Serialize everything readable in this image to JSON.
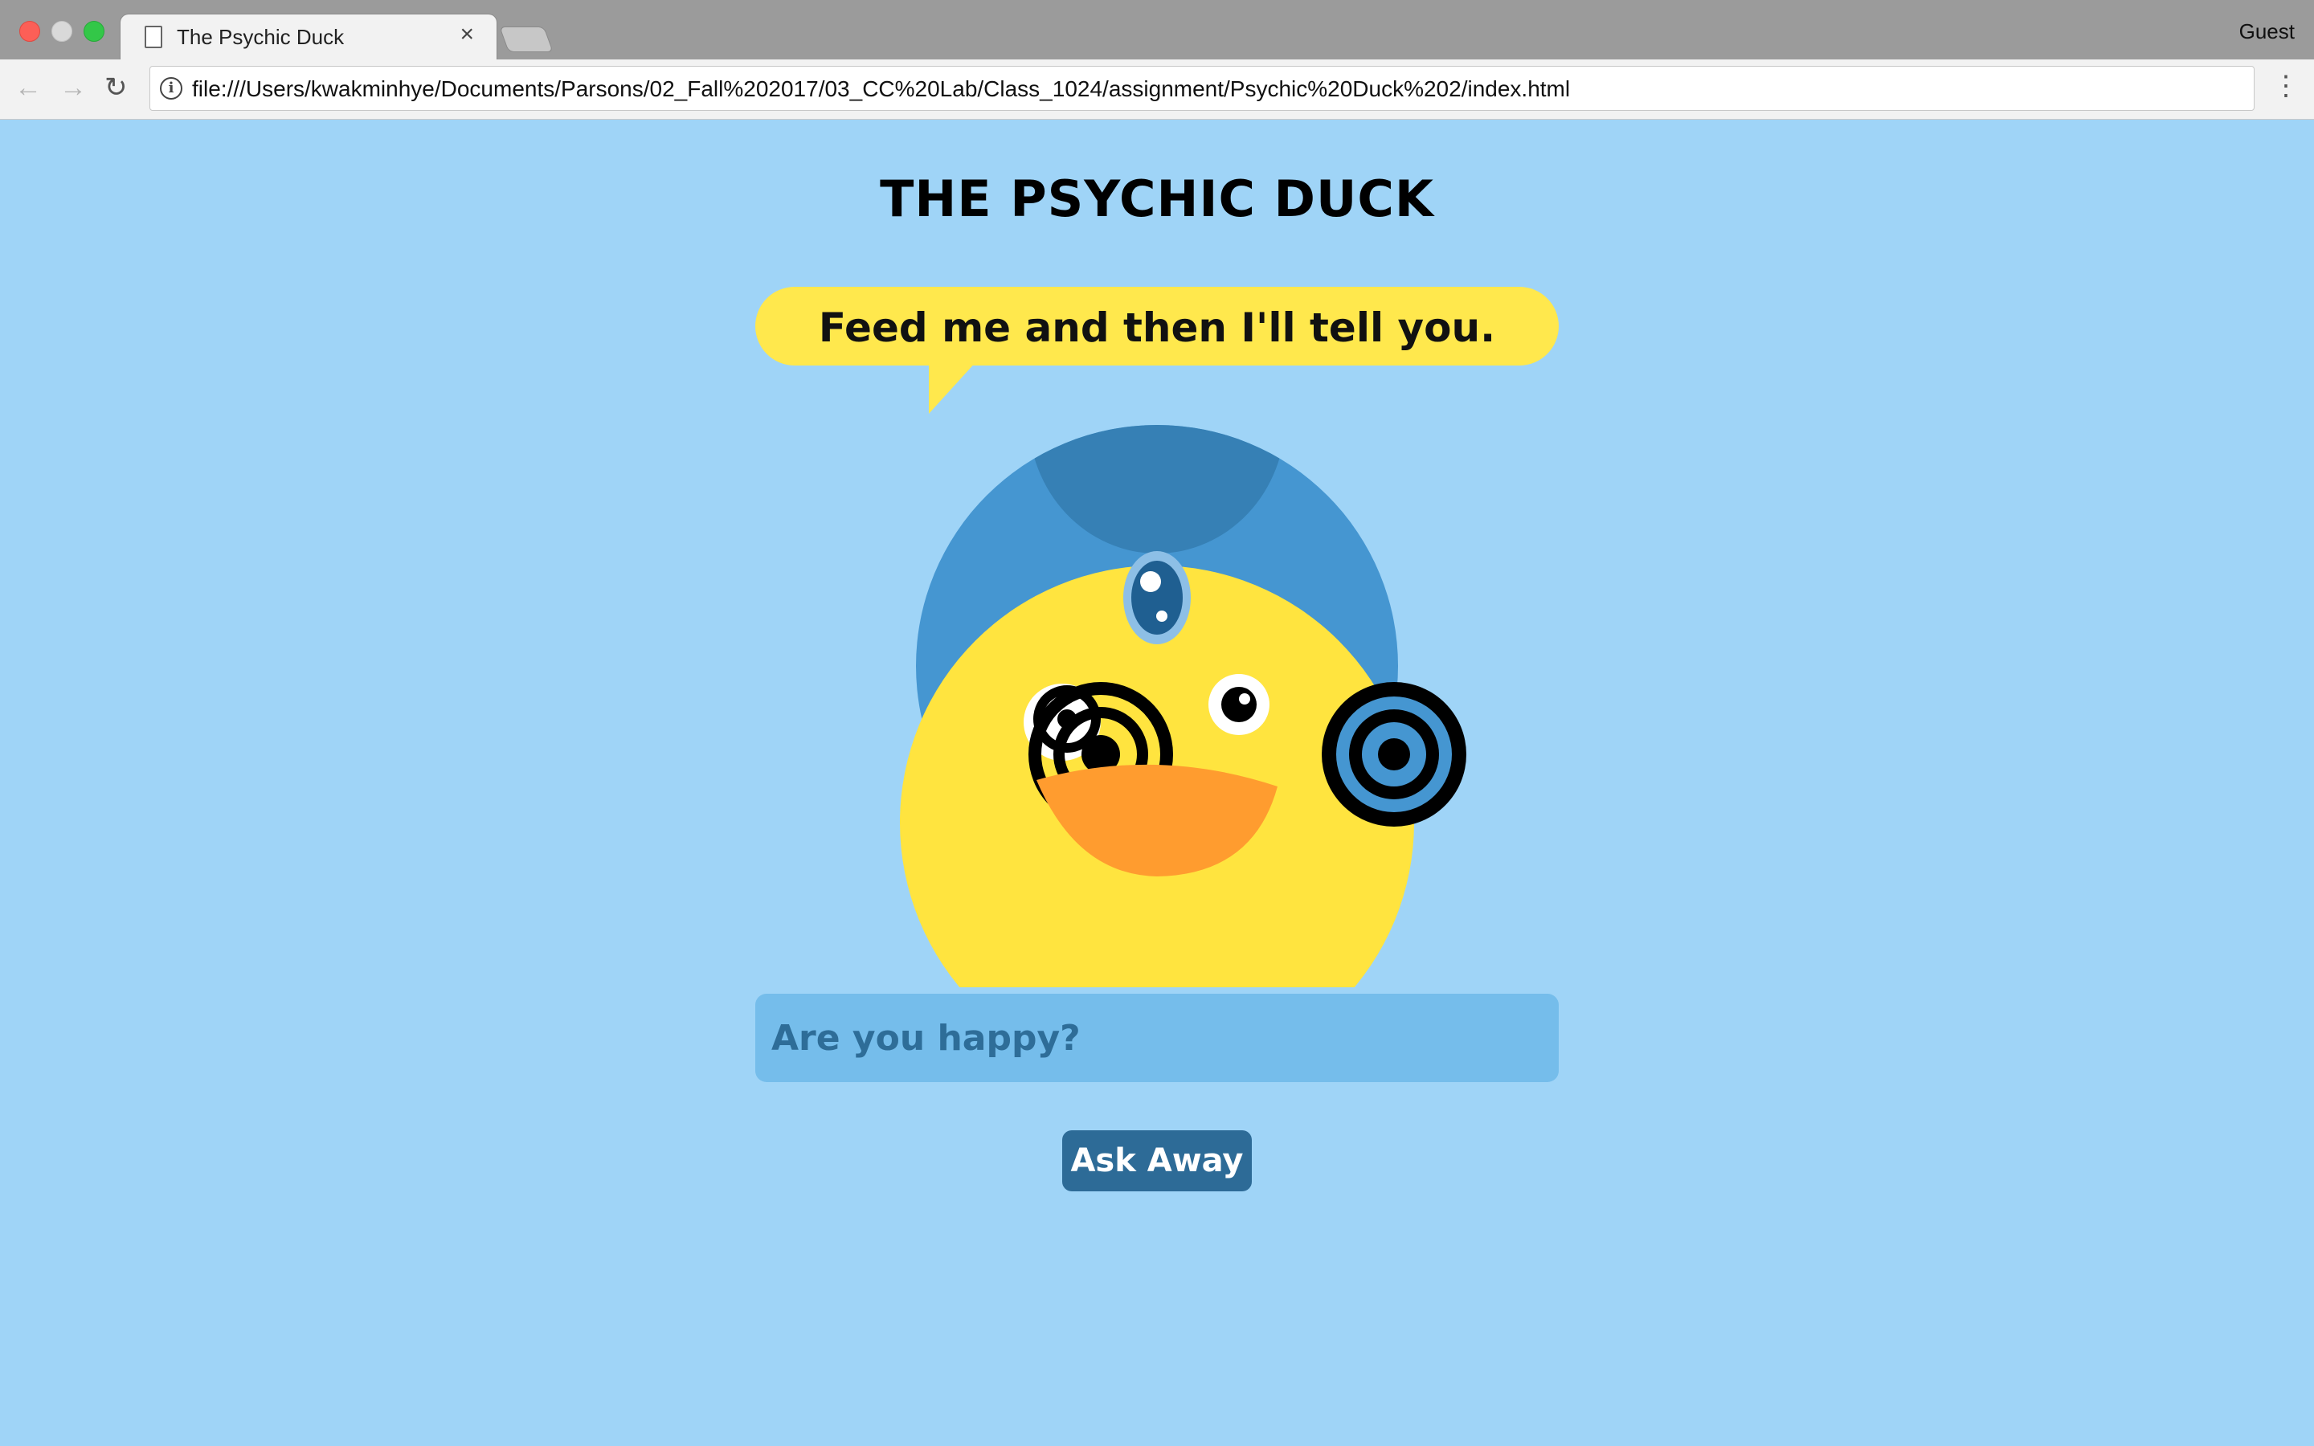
{
  "browser": {
    "tab_title": "The Psychic Duck",
    "tab_close": "×",
    "profile_label": "Guest",
    "url": "file:///Users/kwakminhye/Documents/Parsons/02_Fall%202017/03_CC%20Lab/Class_1024/assignment/Psychic%20Duck%202/index.html",
    "icons": {
      "back": "←",
      "forward": "→",
      "reload": "↻",
      "info": "i",
      "menu": "⋮"
    }
  },
  "page": {
    "title": "THE PSYCHIC DUCK",
    "speech_bubble": "Feed me and then I'll tell you.",
    "question_placeholder": "Are you happy?",
    "question_value": "",
    "ask_button_label": "Ask Away"
  },
  "colors": {
    "background": "#9fd4f7",
    "bubble": "#ffe84d",
    "turban": "#4596d1",
    "turban_dark": "#3680b5",
    "duck_body": "#ffe43f",
    "beak": "#ff9c2f",
    "input_bg": "#75bdeb",
    "button_bg": "#2d6b97"
  }
}
